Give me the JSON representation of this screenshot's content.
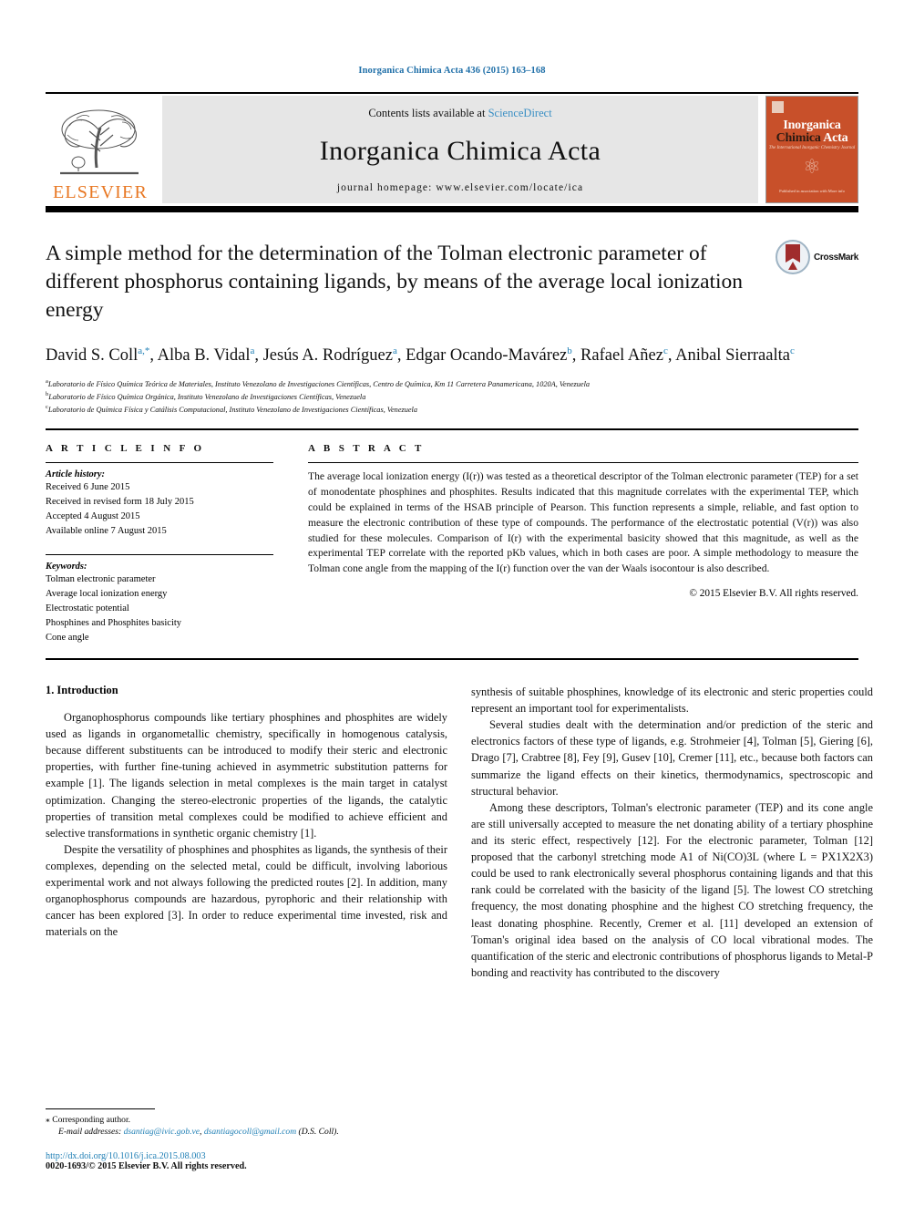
{
  "running_head": "Inorganica Chimica Acta 436 (2015) 163–168",
  "masthead": {
    "publisher_name": "ELSEVIER",
    "contents_prefix": "Contents lists available at ",
    "contents_link": "ScienceDirect",
    "journal_title": "Inorganica Chimica Acta",
    "homepage": "journal homepage: www.elsevier.com/locate/ica",
    "cover": {
      "line1": "Inorganica",
      "line2_dark": "Chimica",
      "line2_light": "Acta",
      "subtitle": "The International Inorganic Chemistry Journal",
      "footer": "Published in association with\nMore info"
    }
  },
  "article": {
    "title": "A simple method for the determination of the Tolman electronic parameter of different phosphorus containing ligands, by means of the average local ionization energy",
    "crossmark_label": "CrossMark",
    "authors_line1": "David S. Coll",
    "authors": [
      {
        "name": "David S. Coll",
        "sup": "a,*"
      },
      {
        "name": "Alba B. Vidal",
        "sup": "a"
      },
      {
        "name": "Jesús A. Rodríguez",
        "sup": "a"
      },
      {
        "name": "Edgar Ocando-Mavárez",
        "sup": "b"
      },
      {
        "name": "Rafael Añez",
        "sup": "c"
      },
      {
        "name": "Anibal Sierraalta",
        "sup": "c"
      }
    ],
    "affiliations": [
      {
        "sup": "a",
        "text": "Laboratorio de Físico Química Teórica de Materiales, Instituto Venezolano de Investigaciones Científicas, Centro de Química, Km 11 Carretera Panamericana, 1020A, Venezuela"
      },
      {
        "sup": "b",
        "text": "Laboratorio de Físico Química Orgánica, Instituto Venezolano de Investigaciones Científicas, Venezuela"
      },
      {
        "sup": "c",
        "text": "Laboratorio de Química Física y Catálisis Computacional, Instituto Venezolano de Investigaciones Científicas, Venezuela"
      }
    ]
  },
  "article_info": {
    "label": "A R T I C L E    I N F O",
    "history_heading": "Article history:",
    "history": [
      "Received 6 June 2015",
      "Received in revised form 18 July 2015",
      "Accepted 4 August 2015",
      "Available online 7 August 2015"
    ],
    "keywords_heading": "Keywords:",
    "keywords": [
      "Tolman electronic parameter",
      "Average local ionization energy",
      "Electrostatic potential",
      "Phosphines and Phosphites basicity",
      "Cone angle"
    ]
  },
  "abstract": {
    "label": "A B S T R A C T",
    "text": "The average local ionization energy (I(r)) was tested as a theoretical descriptor of the Tolman electronic parameter (TEP) for a set of monodentate phosphines and phosphites. Results indicated that this magnitude correlates with the experimental TEP, which could be explained in terms of the HSAB principle of Pearson. This function represents a simple, reliable, and fast option to measure the electronic contribution of these type of compounds. The performance of the electrostatic potential (V(r)) was also studied for these molecules. Comparison of I(r) with the experimental basicity showed that this magnitude, as well as the experimental TEP correlate with the reported pKb values, which in both cases are poor. A simple methodology to measure the Tolman cone angle from the mapping of the I(r) function over the van der Waals isocontour is also described.",
    "copyright": "© 2015 Elsevier B.V. All rights reserved."
  },
  "body": {
    "section_heading": "1. Introduction",
    "left_paragraphs": [
      "Organophosphorus compounds like tertiary phosphines and phosphites are widely used as ligands in organometallic chemistry, specifically in homogenous catalysis, because different substituents can be introduced to modify their steric and electronic properties, with further fine-tuning achieved in asymmetric substitution patterns for example [1]. The ligands selection in metal complexes is the main target in catalyst optimization. Changing the stereo-electronic properties of the ligands, the catalytic properties of transition metal complexes could be modified to achieve efficient and selective transformations in synthetic organic chemistry [1].",
      "Despite the versatility of phosphines and phosphites as ligands, the synthesis of their complexes, depending on the selected metal, could be difficult, involving laborious experimental work and not always following the predicted routes [2]. In addition, many organophosphorus compounds are hazardous, pyrophoric and their relationship with cancer has been explored [3]. In order to reduce experimental time invested, risk and materials on the"
    ],
    "right_paragraphs": [
      "synthesis of suitable phosphines, knowledge of its electronic and steric properties could represent an important tool for experimentalists.",
      "Several studies dealt with the determination and/or prediction of the steric and electronics factors of these type of ligands, e.g. Strohmeier [4], Tolman [5], Giering [6], Drago [7], Crabtree [8], Fey [9], Gusev [10], Cremer [11], etc., because both factors can summarize the ligand effects on their kinetics, thermodynamics, spectroscopic and structural behavior.",
      "Among these descriptors, Tolman's electronic parameter (TEP) and its cone angle are still universally accepted to measure the net donating ability of a tertiary phosphine and its steric effect, respectively [12]. For the electronic parameter, Tolman [12] proposed that the carbonyl stretching mode A1 of Ni(CO)3L (where L = PX1X2X3) could be used to rank electronically several phosphorus containing ligands and that this rank could be correlated with the basicity of the ligand [5]. The lowest CO stretching frequency, the most donating phosphine and the highest CO stretching frequency, the least donating phosphine. Recently, Cremer et al. [11] developed an extension of Toman's original idea based on the analysis of CO local vibrational modes. The quantification of the steric and electronic contributions of phosphorus ligands to Metal-P bonding and reactivity has contributed to the discovery"
    ]
  },
  "footer": {
    "corresponding_marker": "⁎",
    "corresponding_text": "Corresponding author.",
    "email_label": "E-mail addresses:",
    "email1": "dsantiag@ivic.gob.ve",
    "email_sep": ", ",
    "email2": "dsantiagocoll@gmail.com",
    "email_author": " (D.S. Coll).",
    "doi": "http://dx.doi.org/10.1016/j.ica.2015.08.003",
    "issn": "0020-1693/© 2015 Elsevier B.V. All rights reserved."
  },
  "colors": {
    "link_blue": "#1f7fb5",
    "elsevier_orange": "#e87722",
    "cover_red": "#c8502a",
    "masthead_grey": "#e6e6e6"
  }
}
